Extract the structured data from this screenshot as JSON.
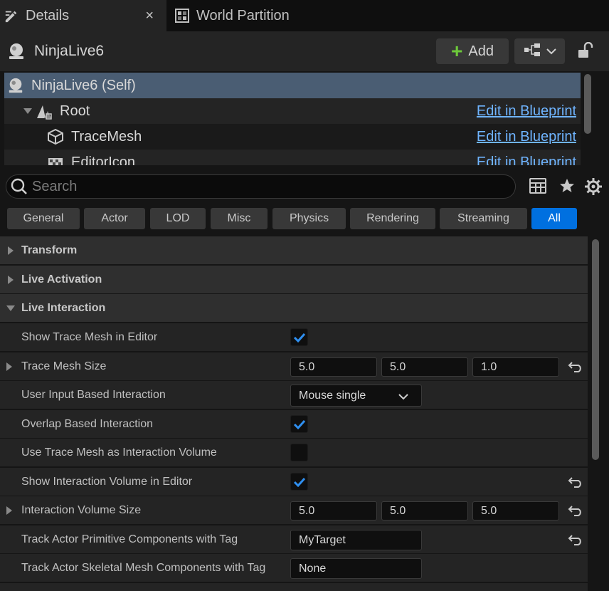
{
  "tabs": [
    {
      "label": "Details",
      "icon": "pencil-details-icon",
      "close": "×"
    },
    {
      "label": "World Partition",
      "icon": "world-partition-grid-icon"
    }
  ],
  "actor": {
    "name": "NinjaLive6",
    "add_label": "Add",
    "add_icon": "plus-icon"
  },
  "tree": {
    "items": [
      {
        "label": "NinjaLive6 (Self)",
        "icon": "actor-icon",
        "selected": true
      },
      {
        "label": "Root",
        "icon": "scene-root-icon",
        "link": "Edit in Blueprint"
      },
      {
        "label": "TraceMesh",
        "icon": "static-mesh-icon",
        "link": "Edit in Blueprint"
      },
      {
        "label": "EditorIcon",
        "icon": "billboard-icon",
        "link": "Edit in Blueprint"
      }
    ]
  },
  "search": {
    "placeholder": "Search"
  },
  "filters": [
    "General",
    "Actor",
    "LOD",
    "Misc",
    "Physics",
    "Rendering",
    "Streaming",
    "All"
  ],
  "active_filter": "All",
  "categories": {
    "transform": "Transform",
    "live_activation": "Live Activation",
    "live_interaction": "Live Interaction"
  },
  "properties": {
    "show_trace_mesh": {
      "label": "Show Trace Mesh in Editor",
      "checked": true
    },
    "trace_mesh_size": {
      "label": "Trace Mesh Size",
      "x": "5.0",
      "y": "5.0",
      "z": "1.0"
    },
    "user_input": {
      "label": "User Input Based Interaction",
      "value": "Mouse single"
    },
    "overlap": {
      "label": "Overlap Based Interaction",
      "checked": true
    },
    "use_trace_volume": {
      "label": "Use Trace Mesh as Interaction Volume",
      "checked": false
    },
    "show_volume": {
      "label": "Show Interaction Volume in Editor",
      "checked": true
    },
    "volume_size": {
      "label": "Interaction Volume Size",
      "x": "5.0",
      "y": "5.0",
      "z": "5.0"
    },
    "track_primitive": {
      "label": "Track Actor Primitive Components with Tag",
      "value": "MyTarget"
    },
    "track_skeletal": {
      "label": "Track Actor Skeletal Mesh Components with Tag",
      "value": "None"
    }
  },
  "colors": {
    "accent": "#0070e0",
    "link": "#6fb4ff",
    "selected_row": "#4a5d73",
    "add_plus": "#6dc93a"
  }
}
